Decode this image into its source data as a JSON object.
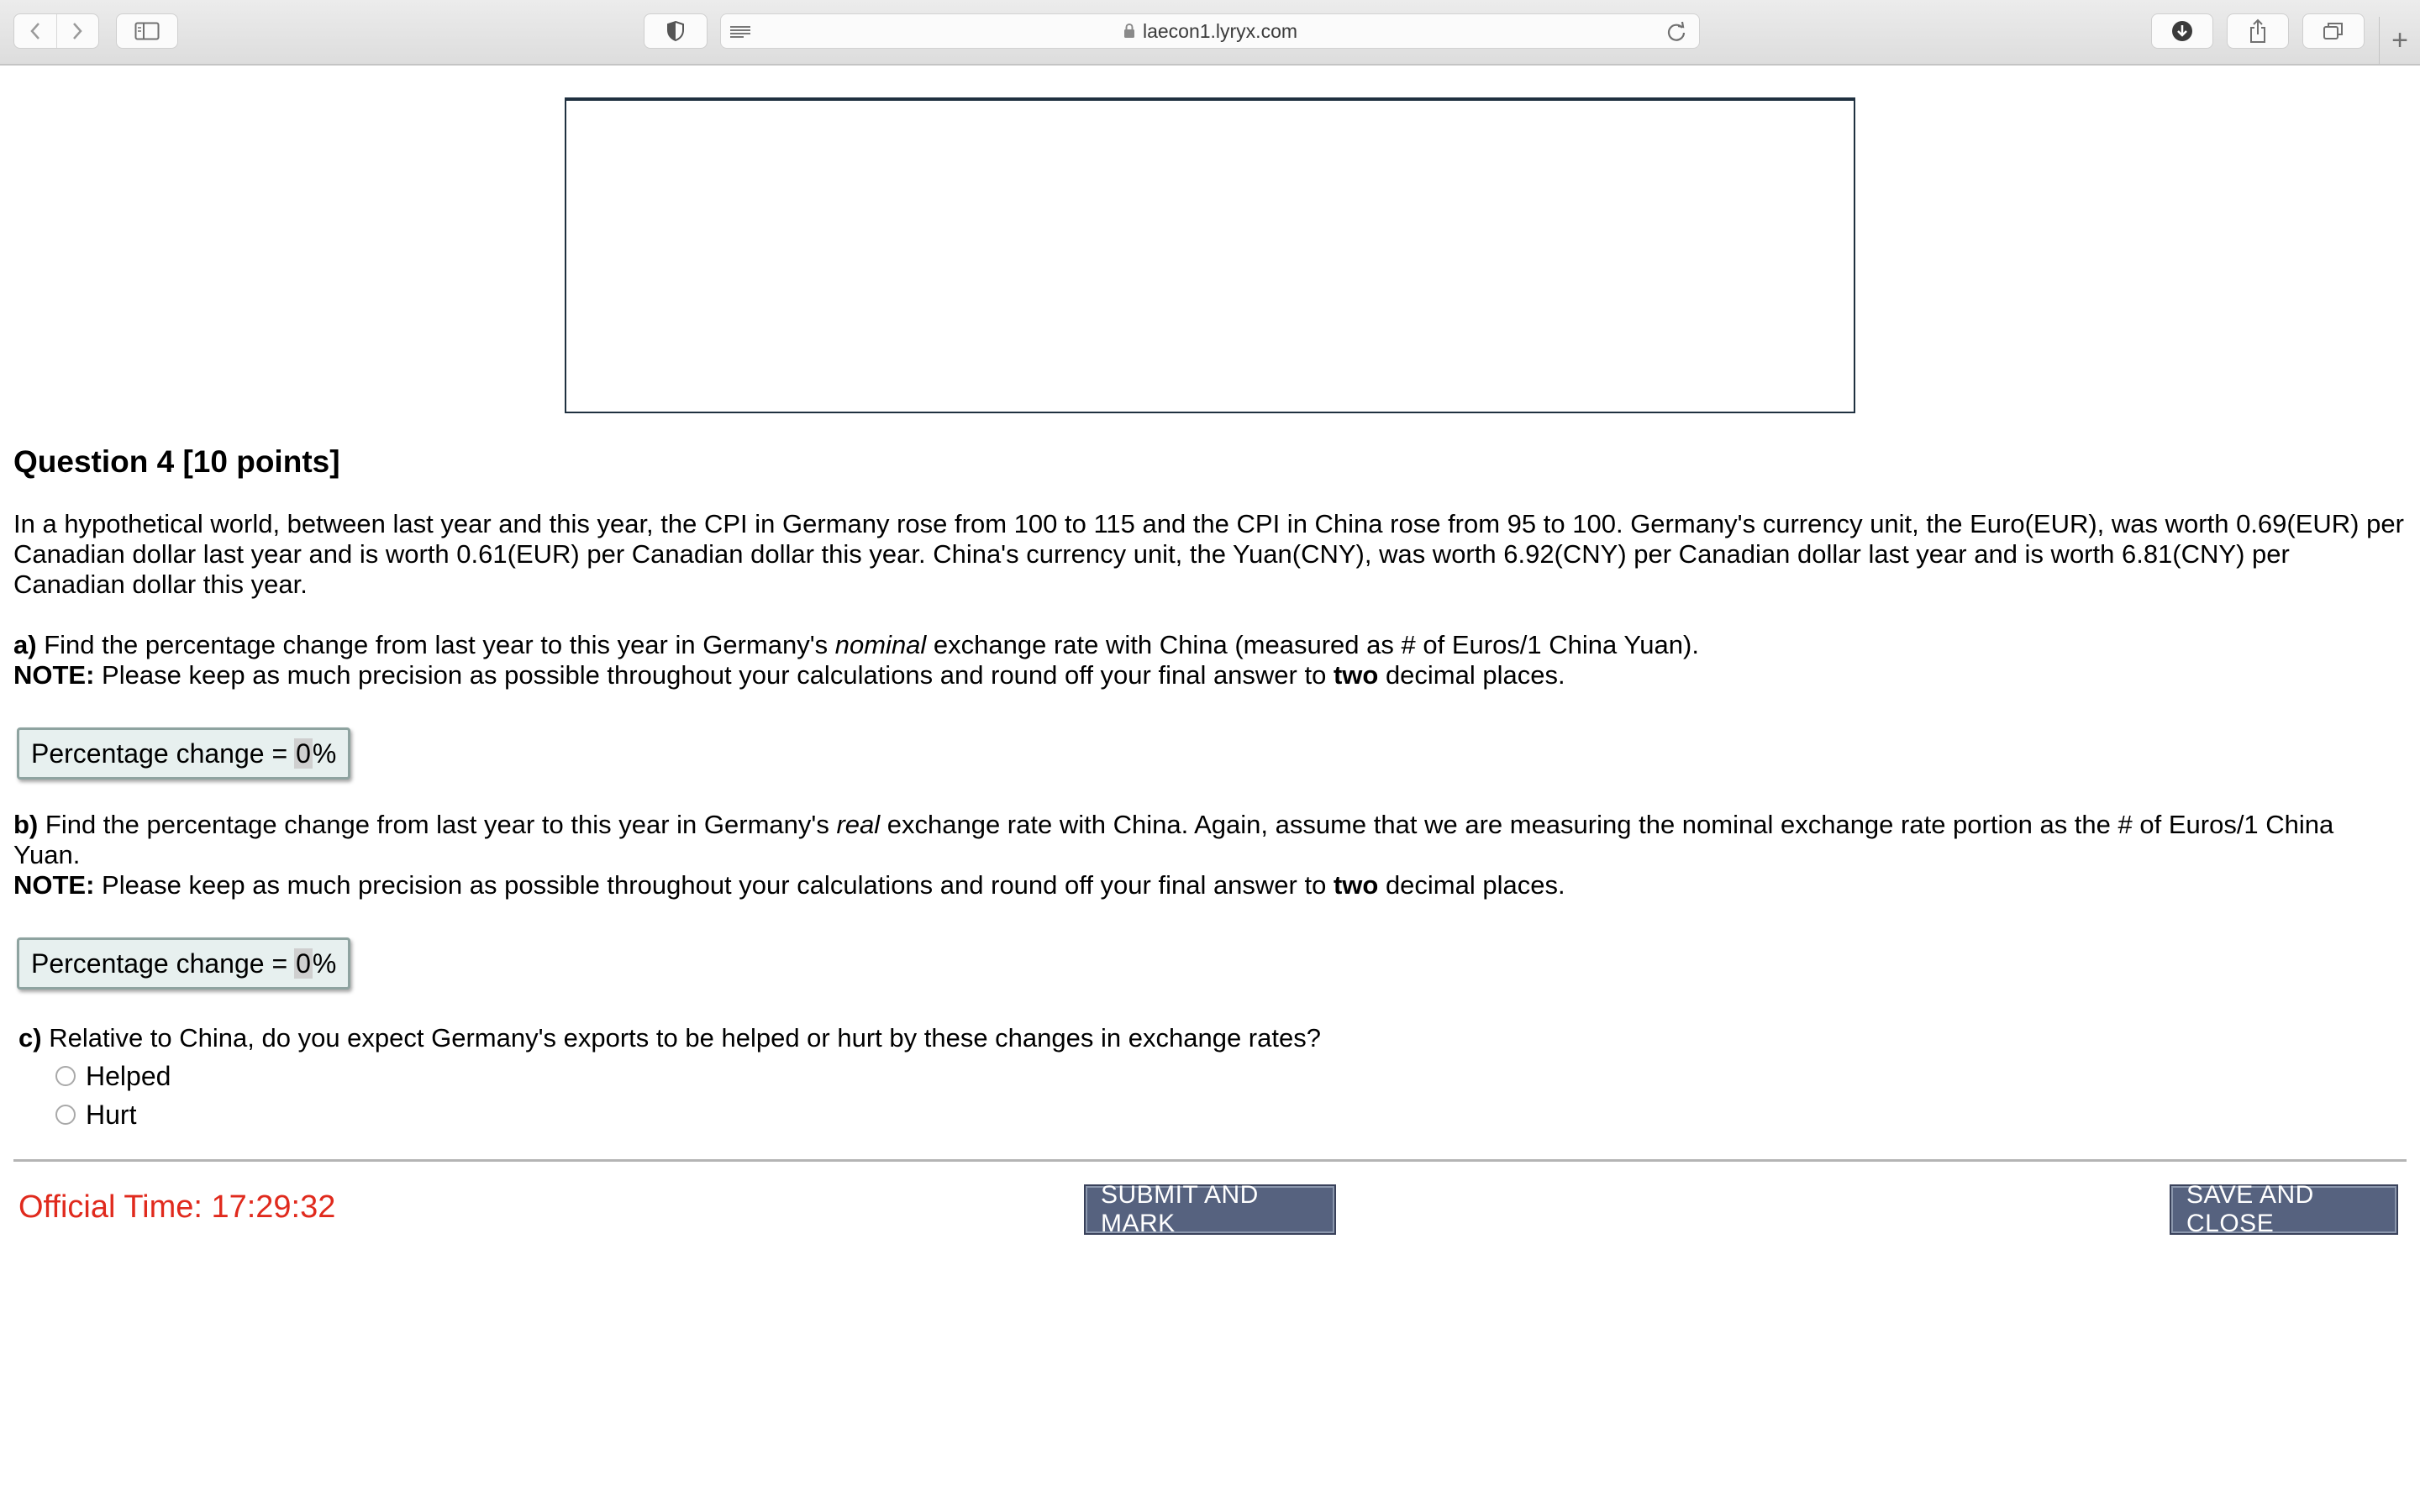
{
  "browser": {
    "url": "laecon1.lyryx.com"
  },
  "question": {
    "title": "Question 4 [10 points]",
    "intro": "In a hypothetical world, between last year and this year, the CPI in Germany rose from 100 to 115 and the CPI in China rose from 95 to 100. Germany's currency unit, the Euro(EUR), was worth 0.69(EUR) per Canadian dollar last year and is worth 0.61(EUR) per Canadian dollar this year. China's currency unit, the Yuan(CNY), was worth 6.92(CNY) per Canadian dollar last year and is worth 6.81(CNY) per Canadian dollar this year.",
    "part_a": {
      "label": "a)",
      "text_before": " Find the percentage change from last year to this year in Germany's ",
      "emphasis": "nominal",
      "text_after": " exchange rate with China (measured as # of Euros/1 China Yuan).",
      "note_label": "NOTE:",
      "note_before": " Please keep as much precision as possible throughout your calculations and round off your final answer to ",
      "note_bold": "two",
      "note_after": " decimal places.",
      "answer_label": "Percentage change =",
      "answer_value": "0",
      "answer_unit": "%"
    },
    "part_b": {
      "label": "b)",
      "text_before": " Find the percentage change from last year to this year in Germany's ",
      "emphasis": "real",
      "text_after": " exchange rate with China. Again, assume that we are measuring the nominal exchange rate portion as the # of Euros/1 China Yuan.",
      "note_label": "NOTE:",
      "note_before": " Please keep as much precision as possible throughout your calculations and round off your final answer to ",
      "note_bold": "two",
      "note_after": " decimal places.",
      "answer_label": "Percentage change =",
      "answer_value": "0",
      "answer_unit": "%"
    },
    "part_c": {
      "label": "c)",
      "text": " Relative to China, do you expect Germany's exports to be helped or hurt by these changes in exchange rates?",
      "options": [
        "Helped",
        "Hurt"
      ]
    }
  },
  "footer": {
    "timer": "Official Time: 17:29:32",
    "submit_label": "SUBMIT AND MARK",
    "save_label": "SAVE AND CLOSE"
  }
}
